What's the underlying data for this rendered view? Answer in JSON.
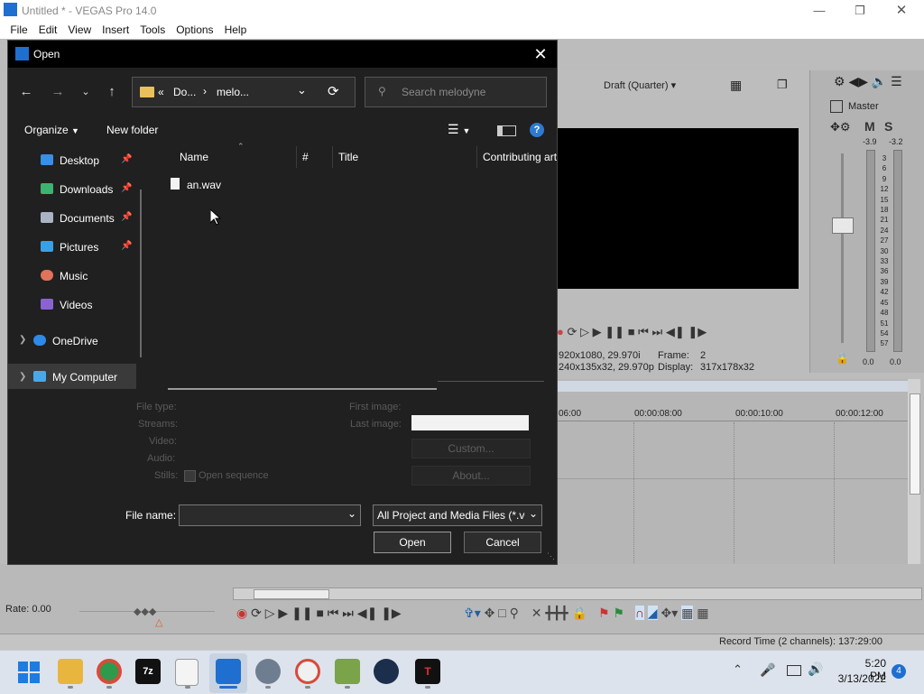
{
  "app": {
    "title": "Untitled * - VEGAS Pro 14.0",
    "menu": [
      "File",
      "Edit",
      "View",
      "Insert",
      "Tools",
      "Options",
      "Help"
    ]
  },
  "vegas": {
    "preview_quality": "Draft (Quarter)",
    "master_label": "Master",
    "master_m": "M",
    "master_s": "S",
    "peak_left": "-3.9",
    "peak_right": "-3.2",
    "meter_scale": [
      "3",
      "6",
      "9",
      "12",
      "15",
      "18",
      "21",
      "24",
      "27",
      "30",
      "33",
      "36",
      "39",
      "42",
      "45",
      "48",
      "51",
      "54",
      "57"
    ],
    "meter_bottom_left": "0.0",
    "meter_bottom_right": "0.0",
    "project_info": "920x1080, 29.970i",
    "preview_info": "240x135x32, 29.970p",
    "frame_label": "Frame:",
    "frame_value": "2",
    "display_label": "Display:",
    "display_value": "317x178x32",
    "timecodes": [
      "06:00",
      "00:00:08:00",
      "00:00:10:00",
      "00:00:12:00"
    ],
    "rate": "Rate: 0.00",
    "record_time": "Record Time (2 channels): 137:29:00"
  },
  "dialog": {
    "title": "Open",
    "breadcrumb": {
      "prefix": "«",
      "part1": "Do...",
      "sep": "›",
      "part2": "melo..."
    },
    "search_placeholder": "Search melodyne",
    "organize": "Organize",
    "new_folder": "New folder",
    "nav_items": [
      {
        "label": "Desktop",
        "color": "#3a8ee6"
      },
      {
        "label": "Downloads",
        "color": "#3cb371"
      },
      {
        "label": "Documents",
        "color": "#aab4c4"
      },
      {
        "label": "Pictures",
        "color": "#3aa0e6"
      },
      {
        "label": "Music",
        "color": "#e0735a"
      },
      {
        "label": "Videos",
        "color": "#8a63d2"
      }
    ],
    "onedrive": "OneDrive",
    "my_computer": "My Computer",
    "columns": [
      "Name",
      "#",
      "Title",
      "Contributing art"
    ],
    "files": [
      {
        "name": "an.wav"
      }
    ],
    "info_labels": {
      "file_type": "File type:",
      "streams": "Streams:",
      "video": "Video:",
      "audio": "Audio:",
      "stills": "Stills:",
      "first_image": "First image:",
      "last_image": "Last image:"
    },
    "open_sequence": "Open sequence",
    "custom_btn": "Custom...",
    "about_btn": "About...",
    "file_name_label": "File name:",
    "file_name_value": "",
    "filter": "All Project and Media Files (*.ve",
    "open_btn": "Open",
    "cancel_btn": "Cancel"
  },
  "taskbar": {
    "time": "5:20 PM",
    "date": "3/13/2022",
    "notification_count": "4"
  }
}
